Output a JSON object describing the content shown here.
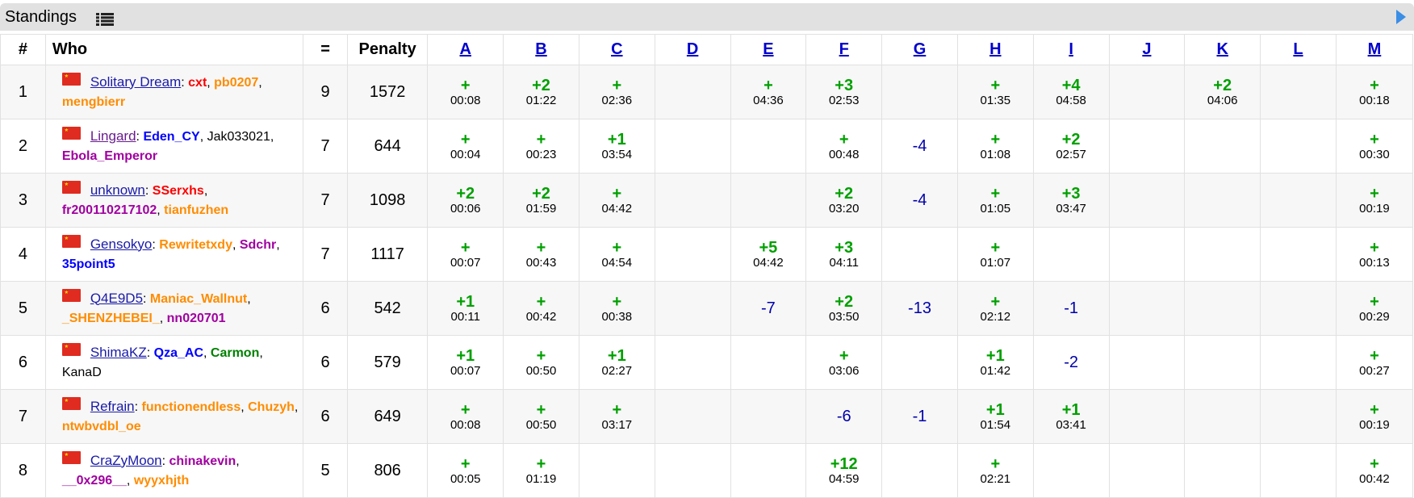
{
  "header": {
    "title": "Standings",
    "list_icon": "list-icon",
    "expand_icon": "arrow-right-icon"
  },
  "columns": {
    "rank": "#",
    "who": "Who",
    "solved": "=",
    "penalty": "Penalty",
    "problems": [
      "A",
      "B",
      "C",
      "D",
      "E",
      "F",
      "G",
      "H",
      "I",
      "J",
      "K",
      "L",
      "M"
    ]
  },
  "rows": [
    {
      "rank": "1",
      "team": "Solitary Dream",
      "team_visited": false,
      "members": [
        {
          "name": "cxt",
          "color": "red"
        },
        {
          "name": "pb0207",
          "color": "orange"
        },
        {
          "name": "mengbierr",
          "color": "orange"
        }
      ],
      "solved": "9",
      "penalty": "1572",
      "cells": [
        {
          "mark": "+",
          "time": "00:08"
        },
        {
          "mark": "+2",
          "time": "01:22"
        },
        {
          "mark": "+",
          "time": "02:36"
        },
        null,
        {
          "mark": "+",
          "time": "04:36"
        },
        {
          "mark": "+3",
          "time": "02:53"
        },
        null,
        {
          "mark": "+",
          "time": "01:35"
        },
        {
          "mark": "+4",
          "time": "04:58"
        },
        null,
        {
          "mark": "+2",
          "time": "04:06"
        },
        null,
        {
          "mark": "+",
          "time": "00:18"
        }
      ]
    },
    {
      "rank": "2",
      "team": "Lingard",
      "team_visited": true,
      "members": [
        {
          "name": "Eden_CY",
          "color": "blue"
        },
        {
          "name": "Jak033021",
          "color": "black"
        },
        {
          "name": "Ebola_Emperor",
          "color": "violet"
        }
      ],
      "solved": "7",
      "penalty": "644",
      "cells": [
        {
          "mark": "+",
          "time": "00:04"
        },
        {
          "mark": "+",
          "time": "00:23"
        },
        {
          "mark": "+1",
          "time": "03:54"
        },
        null,
        null,
        {
          "mark": "+",
          "time": "00:48"
        },
        {
          "mark": "-4"
        },
        {
          "mark": "+",
          "time": "01:08"
        },
        {
          "mark": "+2",
          "time": "02:57"
        },
        null,
        null,
        null,
        {
          "mark": "+",
          "time": "00:30"
        }
      ]
    },
    {
      "rank": "3",
      "team": "unknown",
      "team_visited": false,
      "members": [
        {
          "name": "SSerxhs",
          "color": "red"
        },
        {
          "name": "fr200110217102",
          "color": "violet"
        },
        {
          "name": "tianfuzhen",
          "color": "orange"
        }
      ],
      "solved": "7",
      "penalty": "1098",
      "cells": [
        {
          "mark": "+2",
          "time": "00:06"
        },
        {
          "mark": "+2",
          "time": "01:59"
        },
        {
          "mark": "+",
          "time": "04:42"
        },
        null,
        null,
        {
          "mark": "+2",
          "time": "03:20"
        },
        {
          "mark": "-4"
        },
        {
          "mark": "+",
          "time": "01:05"
        },
        {
          "mark": "+3",
          "time": "03:47"
        },
        null,
        null,
        null,
        {
          "mark": "+",
          "time": "00:19"
        }
      ]
    },
    {
      "rank": "4",
      "team": "Gensokyo",
      "team_visited": false,
      "members": [
        {
          "name": "Rewritetxdy",
          "color": "orange"
        },
        {
          "name": "Sdchr",
          "color": "violet"
        },
        {
          "name": "35point5",
          "color": "blue"
        }
      ],
      "solved": "7",
      "penalty": "1117",
      "cells": [
        {
          "mark": "+",
          "time": "00:07"
        },
        {
          "mark": "+",
          "time": "00:43"
        },
        {
          "mark": "+",
          "time": "04:54"
        },
        null,
        {
          "mark": "+5",
          "time": "04:42"
        },
        {
          "mark": "+3",
          "time": "04:11"
        },
        null,
        {
          "mark": "+",
          "time": "01:07"
        },
        null,
        null,
        null,
        null,
        {
          "mark": "+",
          "time": "00:13"
        }
      ]
    },
    {
      "rank": "5",
      "team": "Q4E9D5",
      "team_visited": false,
      "members": [
        {
          "name": "Maniac_Wallnut",
          "color": "orange"
        },
        {
          "name": "_SHENZHEBEI_",
          "color": "orange"
        },
        {
          "name": "nn020701",
          "color": "violet"
        }
      ],
      "solved": "6",
      "penalty": "542",
      "cells": [
        {
          "mark": "+1",
          "time": "00:11"
        },
        {
          "mark": "+",
          "time": "00:42"
        },
        {
          "mark": "+",
          "time": "00:38"
        },
        null,
        {
          "mark": "-7"
        },
        {
          "mark": "+2",
          "time": "03:50"
        },
        {
          "mark": "-13"
        },
        {
          "mark": "+",
          "time": "02:12"
        },
        {
          "mark": "-1"
        },
        null,
        null,
        null,
        {
          "mark": "+",
          "time": "00:29"
        }
      ]
    },
    {
      "rank": "6",
      "team": "ShimaKZ",
      "team_visited": false,
      "members": [
        {
          "name": "Qza_AC",
          "color": "blue"
        },
        {
          "name": "Carmon",
          "color": "green"
        },
        {
          "name": "KanaD",
          "color": "black"
        }
      ],
      "solved": "6",
      "penalty": "579",
      "cells": [
        {
          "mark": "+1",
          "time": "00:07"
        },
        {
          "mark": "+",
          "time": "00:50"
        },
        {
          "mark": "+1",
          "time": "02:27"
        },
        null,
        null,
        {
          "mark": "+",
          "time": "03:06"
        },
        null,
        {
          "mark": "+1",
          "time": "01:42"
        },
        {
          "mark": "-2"
        },
        null,
        null,
        null,
        {
          "mark": "+",
          "time": "00:27"
        }
      ]
    },
    {
      "rank": "7",
      "team": "Refrain",
      "team_visited": false,
      "members": [
        {
          "name": "functionendless",
          "color": "orange"
        },
        {
          "name": "Chuzyh",
          "color": "orange"
        },
        {
          "name": "ntwbvdbl_oe",
          "color": "orange"
        }
      ],
      "solved": "6",
      "penalty": "649",
      "cells": [
        {
          "mark": "+",
          "time": "00:08"
        },
        {
          "mark": "+",
          "time": "00:50"
        },
        {
          "mark": "+",
          "time": "03:17"
        },
        null,
        null,
        {
          "mark": "-6"
        },
        {
          "mark": "-1"
        },
        {
          "mark": "+1",
          "time": "01:54"
        },
        {
          "mark": "+1",
          "time": "03:41"
        },
        null,
        null,
        null,
        {
          "mark": "+",
          "time": "00:19"
        }
      ]
    },
    {
      "rank": "8",
      "team": "CraZyMoon",
      "team_visited": false,
      "members": [
        {
          "name": "chinakevin",
          "color": "violet"
        },
        {
          "name": "__0x296__",
          "color": "violet"
        },
        {
          "name": "wyyxhjth",
          "color": "orange"
        }
      ],
      "solved": "5",
      "penalty": "806",
      "cells": [
        {
          "mark": "+",
          "time": "00:05"
        },
        {
          "mark": "+",
          "time": "01:19"
        },
        null,
        null,
        null,
        {
          "mark": "+12",
          "time": "04:59"
        },
        null,
        {
          "mark": "+",
          "time": "02:21"
        },
        null,
        null,
        null,
        null,
        {
          "mark": "+",
          "time": "00:42"
        }
      ]
    }
  ]
}
